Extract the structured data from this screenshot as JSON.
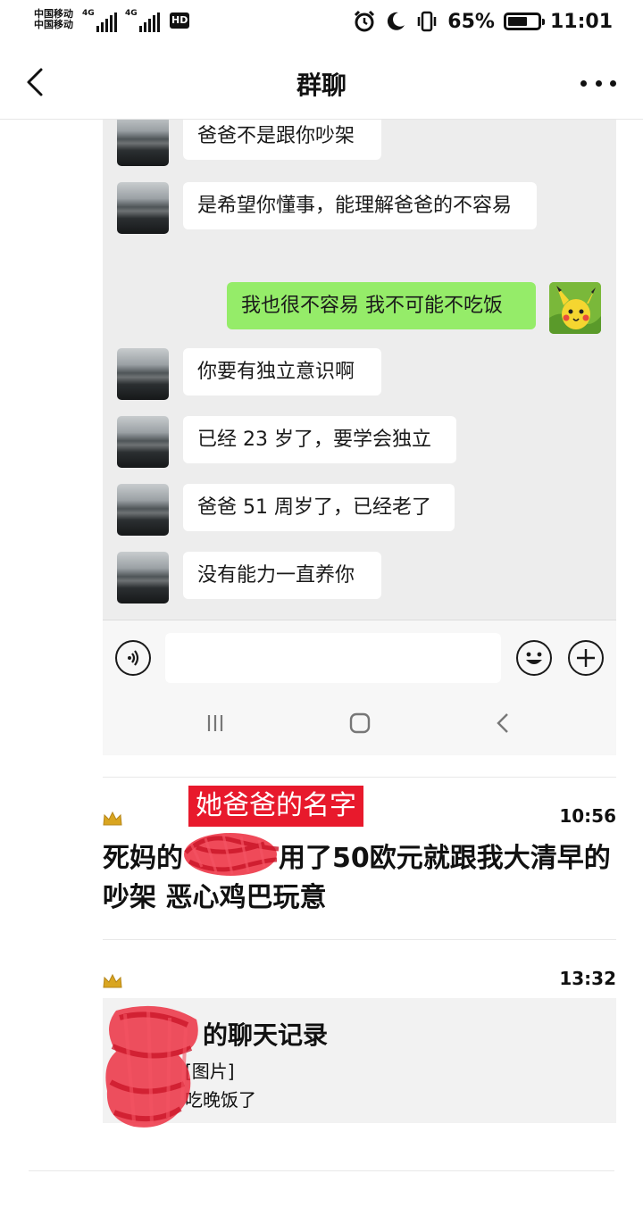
{
  "status_bar": {
    "carrier_1": "中国移动",
    "carrier_2": "中国移动",
    "network_1": "4G",
    "network_2": "4G",
    "hd": "HD",
    "battery": "65%",
    "battery_level": 0.65,
    "time": "11:01",
    "icons": [
      "alarm-icon",
      "moon-icon",
      "vibrate-icon",
      "battery-icon"
    ]
  },
  "nav": {
    "title": "群聊",
    "back_icon": "chevron-left-icon",
    "more_icon": "more-dots-icon"
  },
  "chat": {
    "messages": [
      {
        "side": "left",
        "text": "爸爸不是跟你吵架"
      },
      {
        "side": "left",
        "text": "是希望你懂事，能理解爸爸的不容易"
      },
      {
        "side": "right",
        "text": "我也很不容易 我不可能不吃饭"
      },
      {
        "side": "left",
        "text": "你要有独立意识啊"
      },
      {
        "side": "left",
        "text": "已经 23 岁了，要学会独立"
      },
      {
        "side": "left",
        "text": "爸爸 51 周岁了，已经老了"
      },
      {
        "side": "left",
        "text": "没有能力一直养你"
      }
    ],
    "input_icons": [
      "voice-icon",
      "emoji-icon",
      "plus-icon"
    ],
    "nav_icons": [
      "recent-apps-icon",
      "home-icon",
      "back-icon"
    ]
  },
  "feed": {
    "post1": {
      "label": "她爸爸的名字",
      "time": "10:56",
      "text_before": "死妈的",
      "text_after": "用了50欧元就跟我大清早的吵架 恶心鸡巴玩意"
    },
    "post2": {
      "time": "13:32",
      "card_title": "的聊天记录",
      "line1": "[图片]",
      "line2": "吃晚饭了"
    }
  }
}
